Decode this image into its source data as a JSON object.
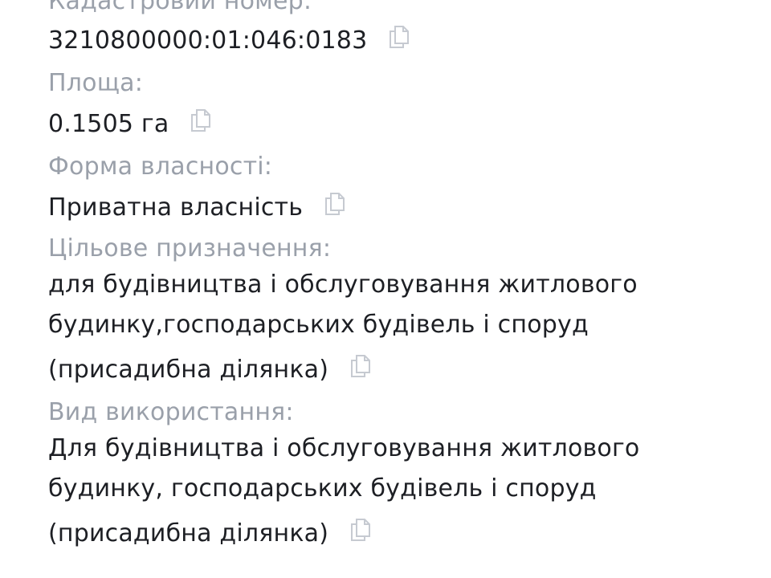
{
  "fields": [
    {
      "label": "Кадастровий номер:",
      "value": "3210800000:01:046:0183"
    },
    {
      "label": "Площа:",
      "value": "0.1505 га"
    },
    {
      "label": "Форма власності:",
      "value": "Приватна власність"
    },
    {
      "label": "Цільове призначення:",
      "value_lines": [
        "для будівництва і обслуговування житлового",
        "будинку,господарських будівель і споруд",
        "(присадибна ділянка)"
      ]
    },
    {
      "label": "Вид використання:",
      "value_lines": [
        "Для будівництва і обслуговування житлового",
        "будинку, господарських будівель і споруд",
        "(присадибна ділянка)"
      ]
    }
  ],
  "icons": {
    "copy": "copy-icon"
  },
  "colors": {
    "label": "#9aa0aa",
    "value": "#1d1f24",
    "icon": "#c6cad1"
  }
}
